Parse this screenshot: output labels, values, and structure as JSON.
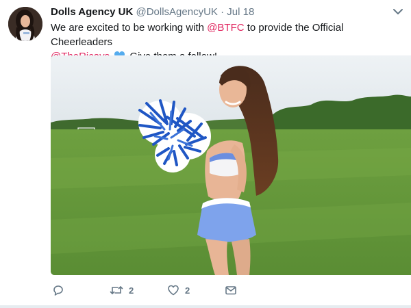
{
  "tweet": {
    "display_name": "Dolls Agency UK",
    "handle": "@DollsAgencyUK",
    "separator": "·",
    "date": "Jul 18",
    "text_part1": "We are excited to be working with ",
    "mention_btfc": "@BTFC",
    "text_part2": " to provide the Official Cheerleaders",
    "mention_ricays": "@TheRicays",
    "text_part3": " Give them a follow!"
  },
  "actions": {
    "reply_count": "",
    "retweet_count": "2",
    "like_count": "2"
  },
  "colors": {
    "mention": "#e0245e",
    "meta": "#657786",
    "heart": "#55acee"
  }
}
